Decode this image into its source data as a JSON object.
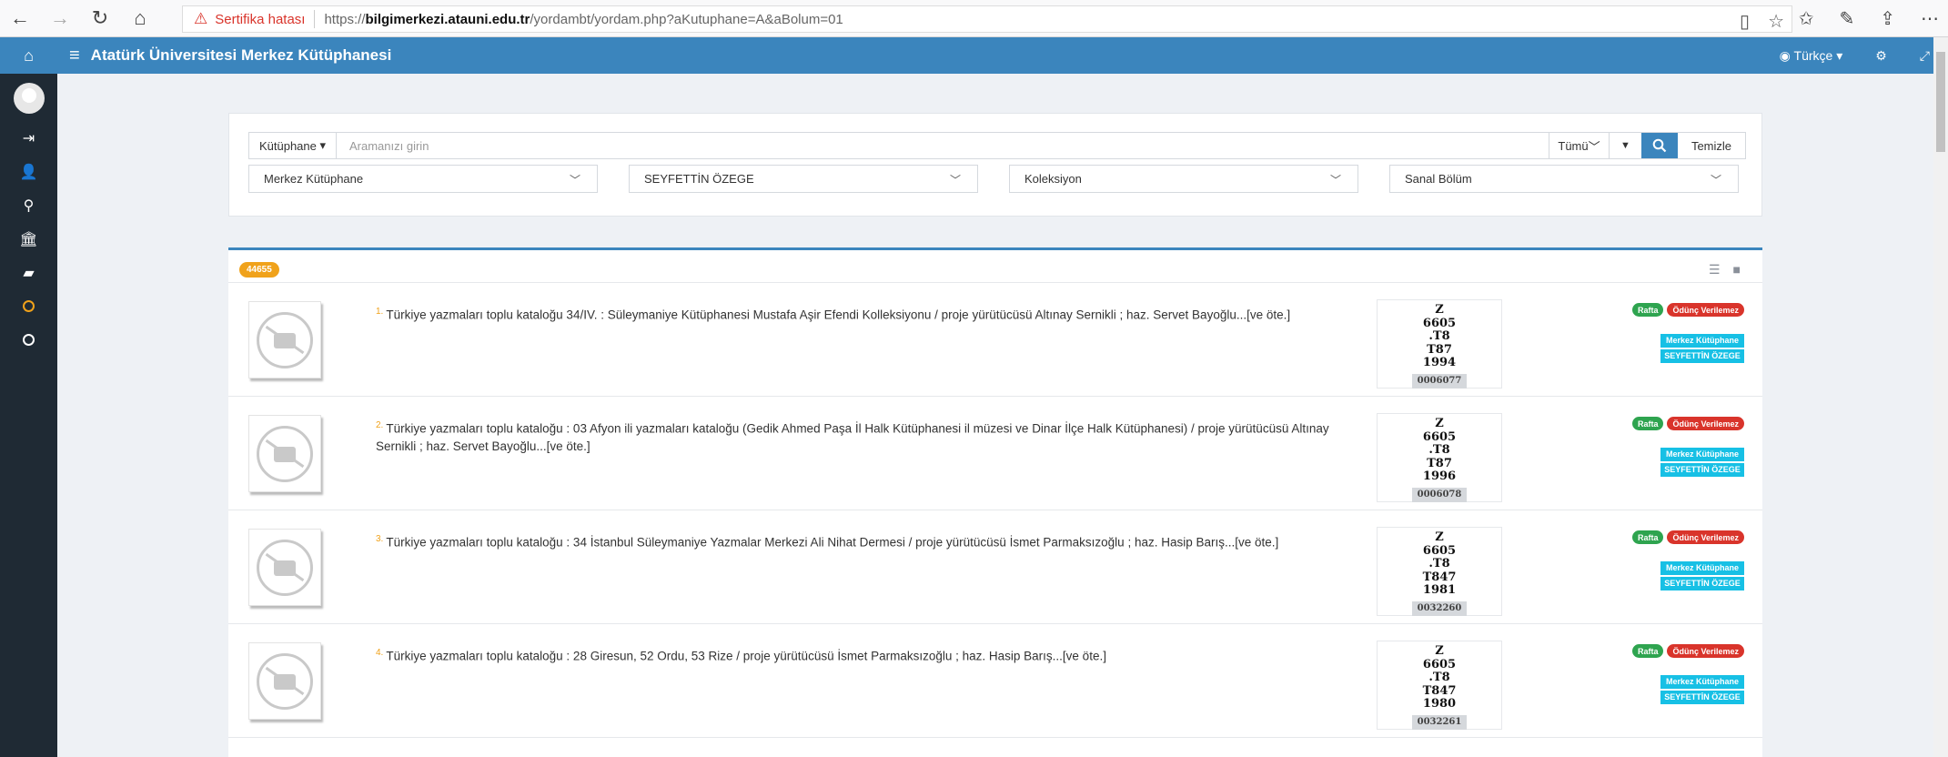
{
  "browser": {
    "back": "←",
    "forward": "→",
    "refresh": "↻",
    "home": "⌂",
    "cert_error": "Sertifika hatası",
    "url_proto": "https://",
    "url_host": "bilgimerkezi.atauni.edu.tr",
    "url_path": "/yordambt/yordam.php?aKutuphane=A&aBolum=01"
  },
  "header": {
    "title": "Atatürk Üniversitesi Merkez Kütüphanesi",
    "language": "Türkçe"
  },
  "search": {
    "library_button": "Kütüphane",
    "placeholder": "Aramanızı girin",
    "scope": "Tümü",
    "clear": "Temizle",
    "selects": [
      "Merkez Kütüphane",
      "SEYFETTİN ÖZEGE",
      "Koleksiyon",
      "Sanal Bölüm"
    ]
  },
  "results": {
    "count": "44655",
    "items": [
      {
        "num": "1.",
        "title": "Türkiye yazmaları toplu kataloğu 34/IV. : Süleymaniye Kütüphanesi Mustafa Aşir Efendi Kolleksiyonu / proje yürütücüsü Altınay Sernikli ; haz. Servet Bayoğlu...[ve öte.]",
        "callno": [
          "Z",
          "6605",
          ".T8",
          "T87",
          "1994"
        ],
        "barcode": "0006077",
        "status": "Rafta",
        "loan": "Ödünç Verilemez",
        "location": "Merkez Kütüphane",
        "section": "SEYFETTİN ÖZEGE"
      },
      {
        "num": "2.",
        "title": "Türkiye yazmaları toplu kataloğu : 03 Afyon ili yazmaları kataloğu (Gedik Ahmed Paşa İl Halk Kütüphanesi il müzesi ve Dinar İlçe Halk Kütüphanesi) / proje yürütücüsü Altınay Sernikli ; haz. Servet Bayoğlu...[ve öte.]",
        "callno": [
          "Z",
          "6605",
          ".T8",
          "T87",
          "1996"
        ],
        "barcode": "0006078",
        "status": "Rafta",
        "loan": "Ödünç Verilemez",
        "location": "Merkez Kütüphane",
        "section": "SEYFETTİN ÖZEGE"
      },
      {
        "num": "3.",
        "title": "Türkiye yazmaları toplu kataloğu : 34 İstanbul Süleymaniye Yazmalar Merkezi Ali Nihat Dermesi / proje yürütücüsü İsmet Parmaksızoğlu ; haz. Hasip Barış...[ve öte.]",
        "callno": [
          "Z",
          "6605",
          ".T8",
          "T847",
          "1981"
        ],
        "barcode": "0032260",
        "status": "Rafta",
        "loan": "Ödünç Verilemez",
        "location": "Merkez Kütüphane",
        "section": "SEYFETTİN ÖZEGE"
      },
      {
        "num": "4.",
        "title": "Türkiye yazmaları toplu kataloğu : 28 Giresun, 52 Ordu, 53 Rize / proje yürütücüsü İsmet Parmaksızoğlu ; haz. Hasip Barış...[ve öte.]",
        "callno": [
          "Z",
          "6605",
          ".T8",
          "T847",
          "1980"
        ],
        "barcode": "0032261",
        "status": "Rafta",
        "loan": "Ödünç Verilemez",
        "location": "Merkez Kütüphane",
        "section": "SEYFETTİN ÖZEGE"
      }
    ]
  }
}
